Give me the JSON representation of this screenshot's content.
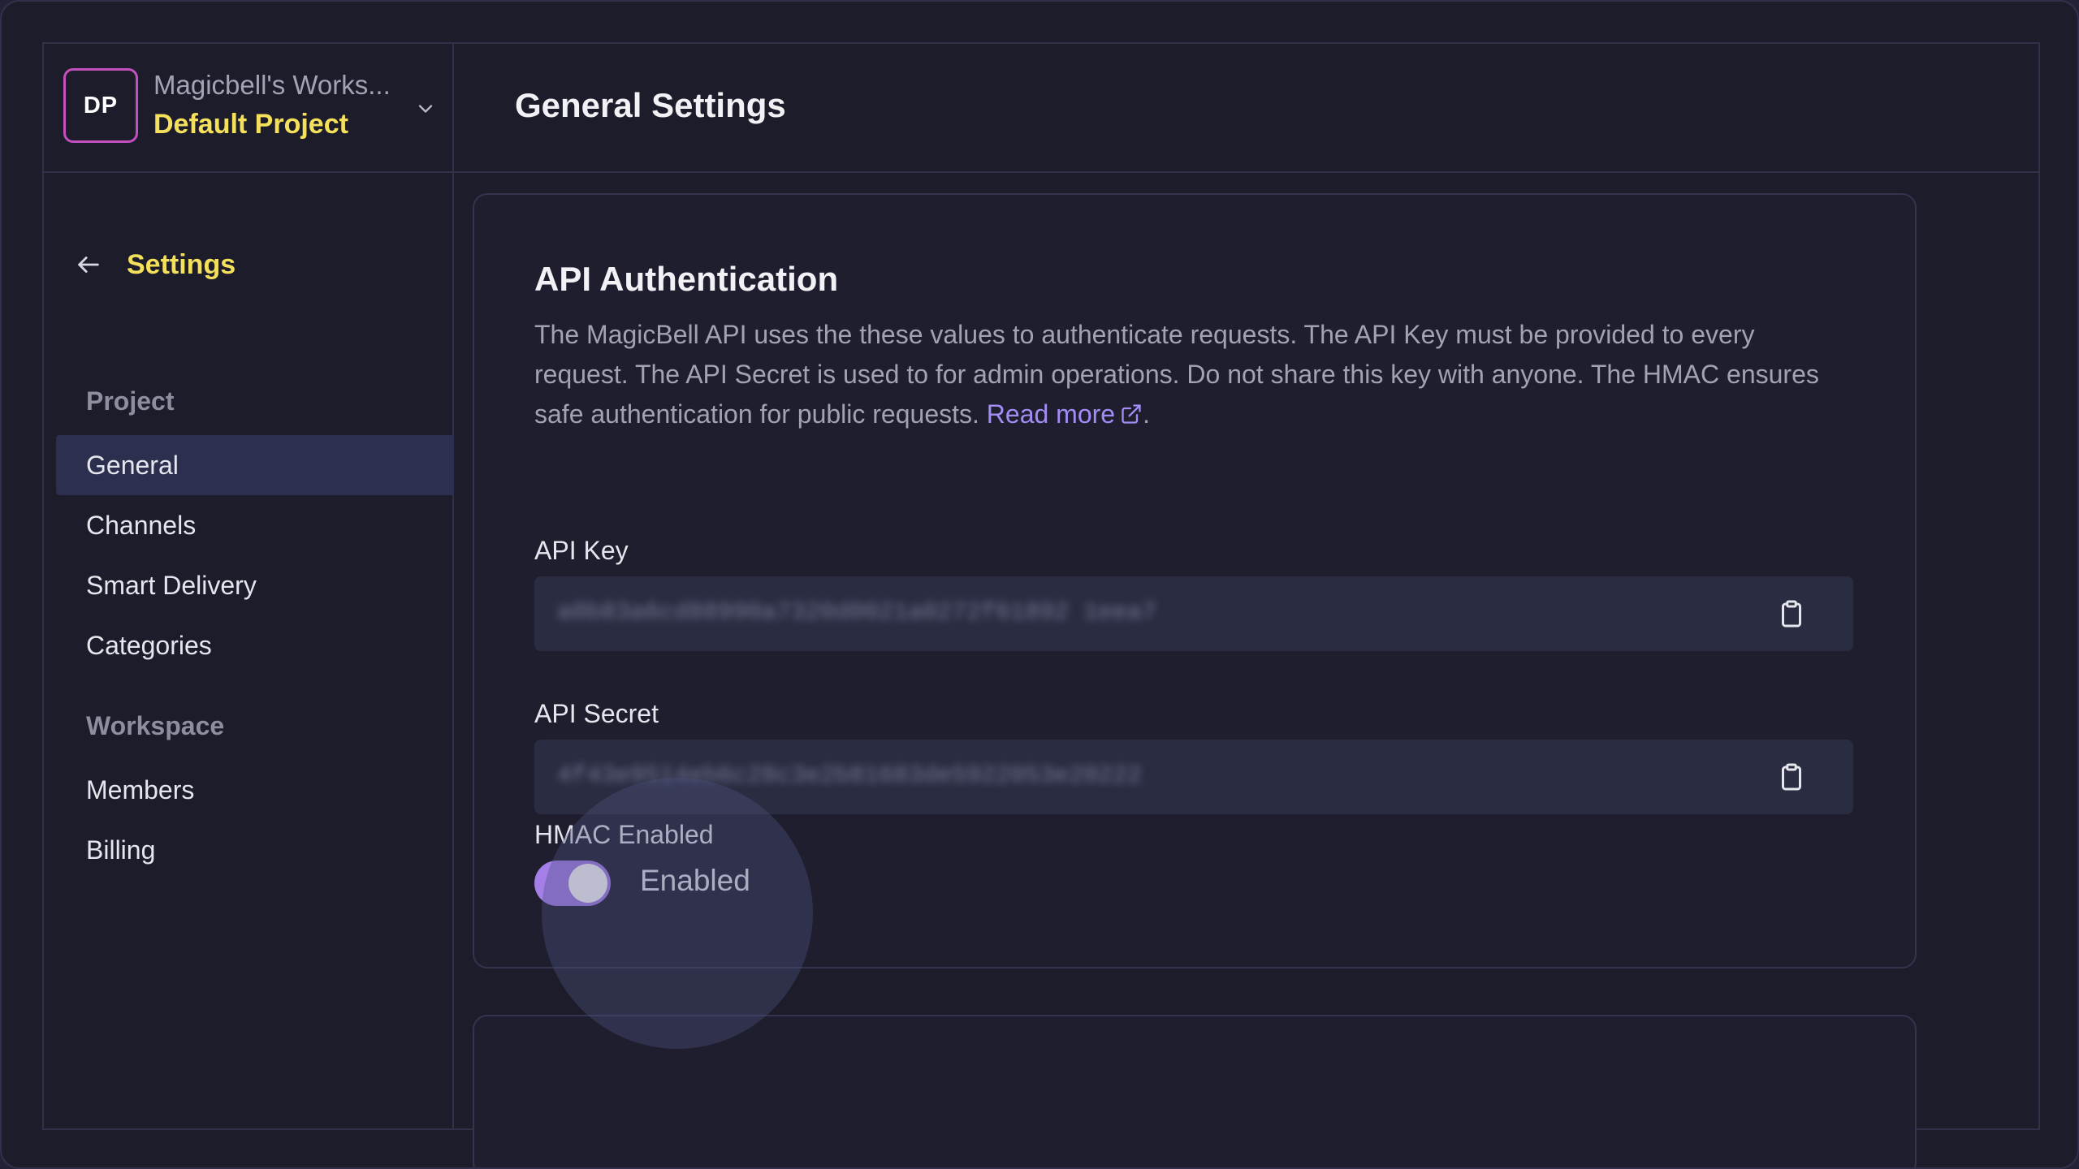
{
  "workspace": {
    "avatar_initials": "DP",
    "name": "Magicbell's Works...",
    "project": "Default Project",
    "chevron_icon": "chevron-down-icon"
  },
  "sidebar": {
    "back_label": "Settings",
    "back_icon": "arrow-left-icon",
    "sections": [
      {
        "title": "Project",
        "items": [
          {
            "label": "General",
            "active": true
          },
          {
            "label": "Channels",
            "active": false
          },
          {
            "label": "Smart Delivery",
            "active": false
          },
          {
            "label": "Categories",
            "active": false
          }
        ]
      },
      {
        "title": "Workspace",
        "items": [
          {
            "label": "Members",
            "active": false
          },
          {
            "label": "Billing",
            "active": false
          }
        ]
      }
    ]
  },
  "header": {
    "title": "General Settings"
  },
  "api_auth": {
    "title": "API Authentication",
    "description": "The MagicBell API uses the these values to authenticate requests. The API Key must be provided to every request. The API Secret is used to for admin operations. Do not share this key with anyone. The HMAC ensures safe authentication for public requests.",
    "read_more": "Read more",
    "read_more_icon": "external-link-icon",
    "trailing_period": ".",
    "api_key": {
      "label": "API Key",
      "value": "a0b83a6cd88990a7320d0021a0272f61892 1eea7",
      "copy_icon": "clipboard-icon"
    },
    "api_secret": {
      "label": "API Secret",
      "value": "4f43e9514eb6c28c3e2b81683de5922053e20222",
      "copy_icon": "clipboard-icon"
    },
    "hmac": {
      "label": "HMAC Enabled",
      "state_text": "Enabled",
      "enabled": true
    }
  },
  "colors": {
    "accent_yellow": "#f4e05a",
    "link_purple": "#a48cf5",
    "toggle_on": "#a47fe8",
    "avatar_border": "#c44fbf",
    "background": "#1c1c2b",
    "active_nav": "#2c2f4d"
  }
}
